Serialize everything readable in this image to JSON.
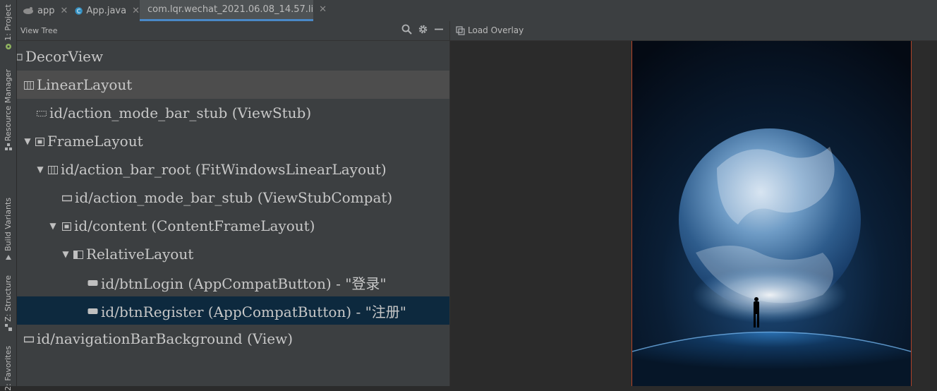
{
  "tabs": [
    {
      "label": "app",
      "icon": "android-module-icon",
      "active": false
    },
    {
      "label": "App.java",
      "icon": "java-class-icon",
      "active": false
    },
    {
      "label": "com.lqr.wechat_2021.06.08_14.57.li",
      "icon": "layout-capture-icon",
      "active": true
    }
  ],
  "side_stripe": {
    "project": "1: Project",
    "resource_manager": "Resource Manager",
    "build_variants": "Build Variants",
    "structure": "Z: Structure",
    "favorites": "2: Favorites"
  },
  "view_tree": {
    "title": "View Tree",
    "tools": [
      "search-icon",
      "gear-icon",
      "minimize-icon"
    ],
    "nodes": [
      {
        "label": "DecorView",
        "expanded": true
      },
      {
        "label": "LinearLayout",
        "expanded": true,
        "selected": "gray"
      },
      {
        "label": "id/action_mode_bar_stub (ViewStub)"
      },
      {
        "label": "FrameLayout",
        "expanded": true
      },
      {
        "label": "id/action_bar_root (FitWindowsLinearLayout)",
        "expanded": true
      },
      {
        "label": "id/action_mode_bar_stub (ViewStubCompat)"
      },
      {
        "label": "id/content (ContentFrameLayout)",
        "expanded": true
      },
      {
        "label": "RelativeLayout",
        "expanded": true
      },
      {
        "label": "id/btnLogin (AppCompatButton) - \"登录\""
      },
      {
        "label": "id/btnRegister (AppCompatButton) - \"注册\"",
        "selected": "blue"
      },
      {
        "label": "id/navigationBarBackground (View)"
      }
    ]
  },
  "preview": {
    "load_overlay_label": "Load Overlay"
  },
  "colors": {
    "panel_bg": "#3c3f41",
    "editor_bg": "#2b2b2b",
    "selection_blue": "#0d293e",
    "selection_gray": "#4d4d4d",
    "tab_accent": "#4a88c7",
    "device_border": "#b24428"
  }
}
